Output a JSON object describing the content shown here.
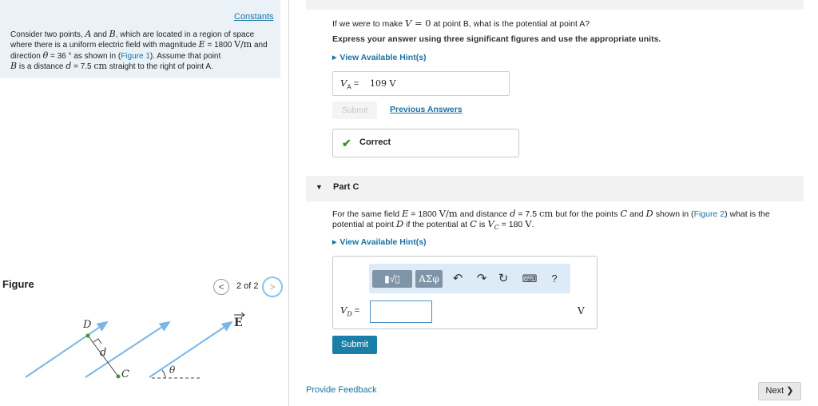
{
  "problem": {
    "constants_link": "Constants",
    "intro": {
      "t1": "Consider two points, ",
      "A": "A",
      "t2": " and ",
      "B": "B",
      "t3": ", which are located in a region of space where there is a uniform electric field with magnitude ",
      "E": "E",
      "t4": " = 1800 ",
      "Eunit": "V/m",
      "t5": " and direction ",
      "theta": "θ",
      "t6": " = 36 ° as shown in (",
      "figure_link": "Figure 1",
      "t7": "). Assume that point ",
      "B2": "B",
      "t8": " is a distance ",
      "d": "d",
      "t9": " = 7.5 ",
      "dunit": "cm",
      "t10": " straight to the right of point A."
    }
  },
  "figure": {
    "title": "Figure",
    "count": "2 of 2",
    "prev_icon": "<",
    "next_icon": ">",
    "labels": {
      "D": "D",
      "d": "d",
      "C": "C",
      "theta": "θ",
      "E": "E"
    },
    "arrow_color": "#7ab6e6",
    "point_color": "#3a9a3a"
  },
  "partB": {
    "q1": "If we were to make ",
    "V": "V",
    "q2": " = 0",
    "q3": " at point B, what is the potential at point A?",
    "instructions": "Express your answer using three significant figures and use the appropriate units.",
    "hint": "View Available Hint(s)",
    "answer_label": "V",
    "answer_sub": "A",
    "answer_eq": " = ",
    "answer_value": "109 V",
    "submit": "Submit",
    "previous_answers": "Previous Answers",
    "result": "Correct",
    "result_icon": "✔"
  },
  "partC": {
    "title": "Part C",
    "caret": "▼",
    "q1": "For the same field ",
    "E": "E",
    "q2": " = 1800 ",
    "Eunit": "V/m",
    "q3": " and distance ",
    "d": "d",
    "q4": " = 7.5 ",
    "dunit": "cm",
    "q5": " but for the points ",
    "C": "C",
    "q6": " and ",
    "D": "D",
    "q7": " shown in (",
    "figure_link": "Figure 2",
    "q8": ") what is the potential at point ",
    "D2": "D",
    "q9": " if the potential at ",
    "C2": "C",
    "q10": " is ",
    "Vc": "V",
    "Vc_sub": "C",
    "q11": " = 180 ",
    "Vunit": "V",
    "q12": ".",
    "hint": "View Available Hint(s)",
    "toolbar": {
      "templates": "▮√▯",
      "symbols": "ΑΣφ",
      "undo": "↶",
      "redo": "↷",
      "reset": "↻",
      "keyboard": "⌨",
      "help": "?"
    },
    "input_label": "V",
    "input_sub": "D",
    "input_eq": " =",
    "input_value": "",
    "unit": "V",
    "submit": "Submit"
  },
  "footer": {
    "feedback": "Provide Feedback",
    "next": "Next ❯"
  }
}
